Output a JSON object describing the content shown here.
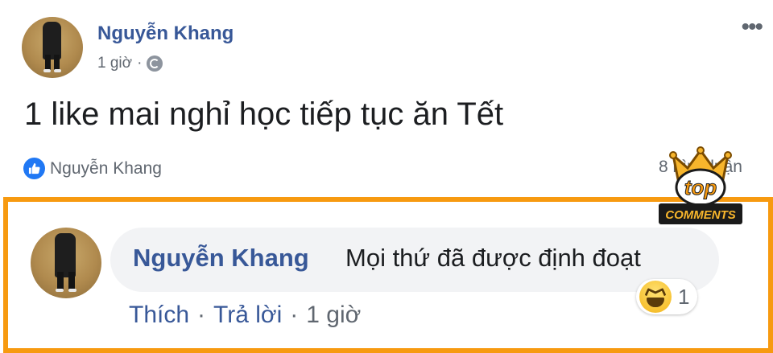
{
  "post": {
    "author": "Nguyễn Khang",
    "time": "1 giờ",
    "separator": "·",
    "more": "•••",
    "text": "1 like mai nghỉ học tiếp tục ăn Tết",
    "likers": "Nguyễn Khang",
    "comments_count": "8 bình luận"
  },
  "badge": {
    "top": "top",
    "comments": "COMMENTS"
  },
  "comment": {
    "author": "Nguyễn Khang",
    "text": "Mọi thứ đã được định đoạt",
    "like_label": "Thích",
    "dot1": "·",
    "reply_label": "Trả lời",
    "dot2": "·",
    "time": "1 giờ",
    "reaction_count": "1",
    "reaction_icon": "haha-icon"
  },
  "colors": {
    "name_blue": "#385898",
    "frame_orange": "#f79a10",
    "like_blue": "#2078f4"
  }
}
